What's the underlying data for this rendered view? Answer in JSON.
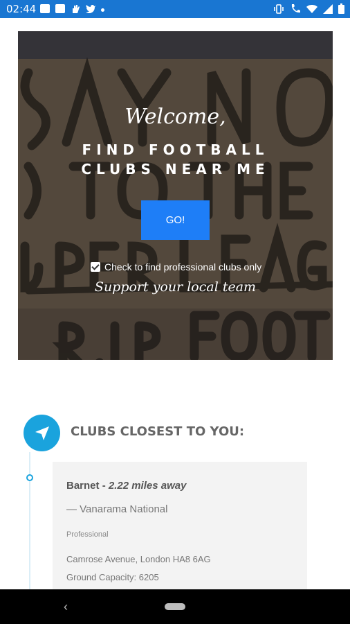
{
  "status_bar": {
    "time": "02:44",
    "icons_left": [
      "image-icon",
      "message-icon",
      "hand-icon",
      "twitter-icon",
      "dot-icon"
    ],
    "icons_right": [
      "vibrate-icon",
      "call-icon",
      "wifi-icon",
      "signal-icon",
      "battery-icon"
    ]
  },
  "hero": {
    "welcome": "Welcome,",
    "headline_line1": "FIND FOOTBALL",
    "headline_line2": "CLUBS NEAR ME",
    "go_button": "GO!",
    "checkbox_label": "Check to find professional clubs only",
    "checkbox_checked": true,
    "tagline": "Support your local team"
  },
  "clubs": {
    "section_title": "CLUBS CLOSEST TO YOU:",
    "items": [
      {
        "name": "Barnet",
        "distance": "2.22 miles away",
        "league": "— Vanarama National",
        "type": "Professional",
        "address": "Camrose Avenue, London HA8 6AG",
        "capacity": "Ground Capacity: 6205"
      }
    ]
  },
  "colors": {
    "status_bar": "#1976d2",
    "accent": "#1aa3dd",
    "button": "#1e7ef7"
  }
}
